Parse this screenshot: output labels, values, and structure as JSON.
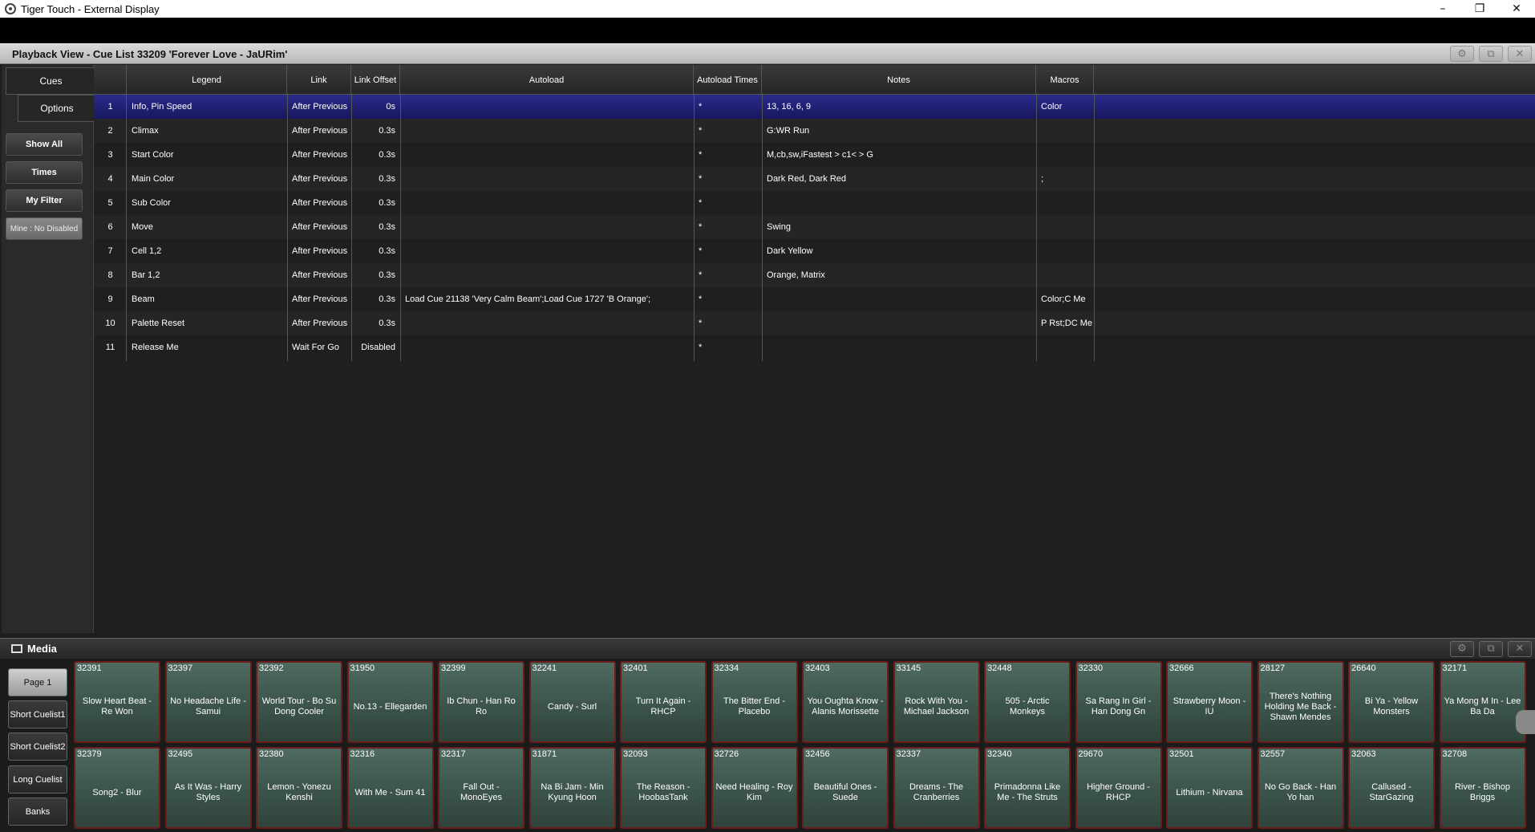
{
  "window": {
    "title": "Tiger Touch - External Display",
    "controls": [
      "–",
      "❐",
      "✕"
    ]
  },
  "playback": {
    "title": "Playback View - Cue List 33209 'Forever Love - JaURim'",
    "header_icons": [
      "gear-icon",
      "restore-icon",
      "close-icon"
    ]
  },
  "side": {
    "tabs": [
      "Cues",
      "Options"
    ],
    "buttons": [
      "Show All",
      "Times",
      "My Filter"
    ],
    "mine": "Mine : No Disabled"
  },
  "table": {
    "columns": [
      "Legend",
      "Link",
      "Link Offset",
      "Autoload",
      "Autoload Times",
      "Notes",
      "Macros"
    ],
    "rows": [
      {
        "n": "1",
        "legend": "Info, Pin Speed",
        "link": "After Previous",
        "offset": "0s",
        "autoload": "",
        "times": "*",
        "notes": "13, 16, 6, 9",
        "macros": "Color"
      },
      {
        "n": "2",
        "legend": "Climax",
        "link": "After Previous",
        "offset": "0.3s",
        "autoload": "",
        "times": "*",
        "notes": "G:WR Run",
        "macros": ""
      },
      {
        "n": "3",
        "legend": "Start Color",
        "link": "After Previous",
        "offset": "0.3s",
        "autoload": "",
        "times": "*",
        "notes": "M,cb,sw,iFastest > c1< > G",
        "macros": ""
      },
      {
        "n": "4",
        "legend": "Main Color",
        "link": "After Previous",
        "offset": "0.3s",
        "autoload": "",
        "times": "*",
        "notes": "Dark Red, Dark Red",
        "macros": ";"
      },
      {
        "n": "5",
        "legend": "Sub Color",
        "link": "After Previous",
        "offset": "0.3s",
        "autoload": "",
        "times": "*",
        "notes": "",
        "macros": ""
      },
      {
        "n": "6",
        "legend": "Move",
        "link": "After Previous",
        "offset": "0.3s",
        "autoload": "",
        "times": "*",
        "notes": "Swing",
        "macros": ""
      },
      {
        "n": "7",
        "legend": "Cell 1,2",
        "link": "After Previous",
        "offset": "0.3s",
        "autoload": "",
        "times": "*",
        "notes": "Dark Yellow",
        "macros": ""
      },
      {
        "n": "8",
        "legend": "Bar 1,2",
        "link": "After Previous",
        "offset": "0.3s",
        "autoload": "",
        "times": "*",
        "notes": "Orange, Matrix",
        "macros": ""
      },
      {
        "n": "9",
        "legend": "Beam",
        "link": "After Previous",
        "offset": "0.3s",
        "autoload": "Load Cue 21138 'Very Calm Beam';Load Cue 1727 'B Orange';",
        "times": "*",
        "notes": "",
        "macros": "Color;C Me"
      },
      {
        "n": "10",
        "legend": "Palette Reset",
        "link": "After Previous",
        "offset": "0.3s",
        "autoload": "",
        "times": "*",
        "notes": "",
        "macros": "P Rst;DC Me"
      },
      {
        "n": "11",
        "legend": "Release Me",
        "link": "Wait For Go",
        "offset": "Disabled",
        "autoload": "",
        "times": "*",
        "notes": "",
        "macros": ""
      }
    ]
  },
  "media": {
    "title": "Media",
    "pages": [
      "Page 1",
      "Short Cuelist1",
      "Short Cuelist2",
      "Long Cuelist",
      "Banks"
    ],
    "tiles_row1": [
      {
        "num": "32391",
        "label": "Slow Heart Beat - Re Won"
      },
      {
        "num": "32397",
        "label": "No Headache Life - Samui"
      },
      {
        "num": "32392",
        "label": "World Tour - Bo Su Dong Cooler"
      },
      {
        "num": "31950",
        "label": "No.13 - Ellegarden"
      },
      {
        "num": "32399",
        "label": "Ib Chun - Han Ro Ro"
      },
      {
        "num": "32241",
        "label": "Candy - Surl"
      },
      {
        "num": "32401",
        "label": "Turn It Again - RHCP"
      },
      {
        "num": "32334",
        "label": "The Bitter End - Placebo"
      },
      {
        "num": "32403",
        "label": "You Oughta Know - Alanis Morissette"
      },
      {
        "num": "33145",
        "label": "Rock With You - Michael Jackson"
      },
      {
        "num": "32448",
        "label": "505 - Arctic Monkeys"
      },
      {
        "num": "32330",
        "label": "Sa Rang In Girl - Han Dong Gn"
      },
      {
        "num": "32666",
        "label": "Strawberry Moon - IU"
      },
      {
        "num": "28127",
        "label": "There's Nothing Holding Me Back - Shawn Mendes"
      },
      {
        "num": "26640",
        "label": "Bi Ya - Yellow Monsters"
      },
      {
        "num": "32171",
        "label": "Ya Mong M In - Lee Ba Da"
      }
    ],
    "tiles_row2": [
      {
        "num": "32379",
        "label": "Song2 - Blur"
      },
      {
        "num": "32495",
        "label": "As It Was - Harry Styles"
      },
      {
        "num": "32380",
        "label": "Lemon - Yonezu Kenshi"
      },
      {
        "num": "32316",
        "label": "With Me - Sum 41"
      },
      {
        "num": "32317",
        "label": "Fall Out - MonoEyes"
      },
      {
        "num": "31871",
        "label": "Na Bi Jam - Min Kyung Hoon"
      },
      {
        "num": "32093",
        "label": "The Reason - HoobasTank"
      },
      {
        "num": "32726",
        "label": "Need Healing - Roy Kim"
      },
      {
        "num": "32456",
        "label": "Beautiful Ones - Suede"
      },
      {
        "num": "32337",
        "label": "Dreams - The Cranberries"
      },
      {
        "num": "32340",
        "label": "Primadonna Like Me - The Struts"
      },
      {
        "num": "29670",
        "label": "Higher Ground - RHCP"
      },
      {
        "num": "32501",
        "label": "Lithium - Nirvana"
      },
      {
        "num": "32557",
        "label": "No Go Back - Han Yo han"
      },
      {
        "num": "32063",
        "label": "Callused - StarGazing"
      },
      {
        "num": "32708",
        "label": "River - Bishop Briggs"
      }
    ]
  }
}
